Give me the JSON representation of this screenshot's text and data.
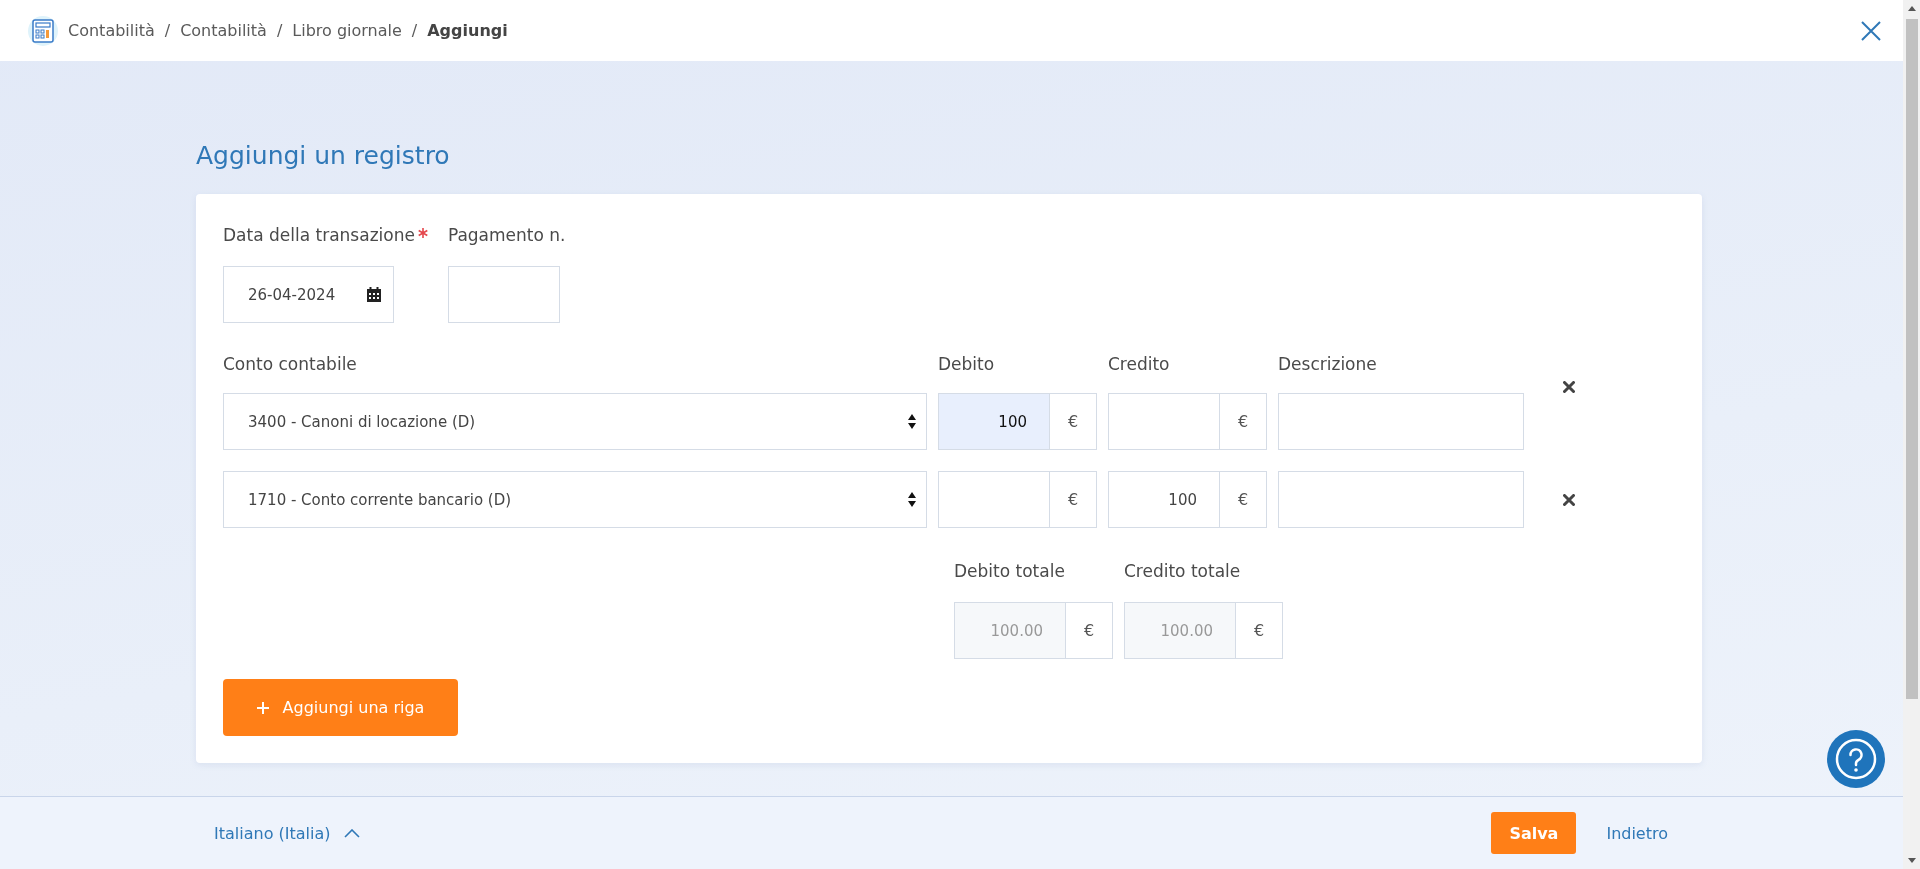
{
  "breadcrumb": [
    {
      "label": "Contabilità",
      "current": false
    },
    {
      "label": "Contabilità",
      "current": false
    },
    {
      "label": "Libro giornale",
      "current": false
    },
    {
      "label": "Aggiungi",
      "current": true
    }
  ],
  "separator": "/",
  "title": "Aggiungi un registro",
  "form": {
    "date": {
      "label": "Data della transazione",
      "required": true,
      "value": "26-04-2024"
    },
    "payment": {
      "label": "Pagamento n."
    },
    "columns": {
      "account": "Conto contabile",
      "debit": "Debito",
      "credit": "Credito",
      "description": "Descrizione"
    },
    "currency": "€",
    "lines": [
      {
        "account": "3400 - Canoni di locazione (D)",
        "debit": "100",
        "debit_highlighted": true
      },
      {
        "account": "1710 - Conto corrente bancario (D)",
        "credit": "100",
        "debit_highlighted": false
      }
    ],
    "totals": [
      {
        "label": "Debito totale",
        "value": "100.00"
      },
      {
        "label": "Credito totale",
        "value": "100.00"
      }
    ],
    "add_button": "Aggiungi una riga"
  },
  "footer": {
    "language": "Italiano (Italia)",
    "save_button": "Salva",
    "back_link": "Indietro"
  }
}
